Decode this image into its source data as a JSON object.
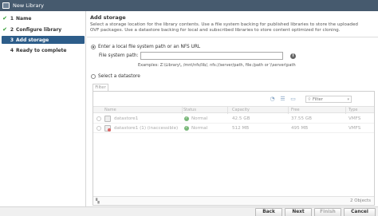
{
  "window": {
    "title": "New Library"
  },
  "steps": [
    {
      "num": "1",
      "label": "Name",
      "done": true
    },
    {
      "num": "2",
      "label": "Configure library",
      "done": true
    },
    {
      "num": "3",
      "label": "Add storage",
      "done": false
    },
    {
      "num": "4",
      "label": "Ready to complete",
      "done": false
    }
  ],
  "content": {
    "title": "Add storage",
    "description": "Select a storage location for the library contents. Use a file system backing for published libraries to store the uploaded OVF packages. Use a datastore backing for local and subscribed libraries to store content optimized for cloning."
  },
  "local_option": {
    "label": "Enter a local file system path or an NFS URL",
    "path_label": "File system path:",
    "path_value": "",
    "examples": "Examples: Z:\\Library\\, /mnt/nfs/lib/, nfs://server/path, file:/path or \\\\server\\path"
  },
  "datastore_option": {
    "label": "Select a datastore"
  },
  "filter": {
    "tab_label": "Filter",
    "placeholder": "Filter"
  },
  "table": {
    "columns": [
      "Name",
      "Status",
      "Capacity",
      "Free",
      "Type"
    ],
    "rows": [
      {
        "name": "datastore1",
        "status": "Normal",
        "capacity": "42.5 GB",
        "free": "37.55 GB",
        "type": "VMFS",
        "inaccessible": false
      },
      {
        "name": "datastore1 (1) (inaccessible)",
        "status": "Normal",
        "capacity": "512 MB",
        "free": "495 MB",
        "type": "VMFS",
        "inaccessible": true
      }
    ],
    "object_count": "2 Objects"
  },
  "buttons": {
    "back": "Back",
    "next": "Next",
    "finish": "Finish",
    "cancel": "Cancel"
  },
  "colors": {
    "titlebar": "#465a6e",
    "active_step": "#2d5d8a",
    "check": "#2c9a2c",
    "status_ok": "#7ab87a"
  },
  "icons": {
    "info": "info-icon",
    "check": "check-icon",
    "filter": "filter-icon"
  }
}
